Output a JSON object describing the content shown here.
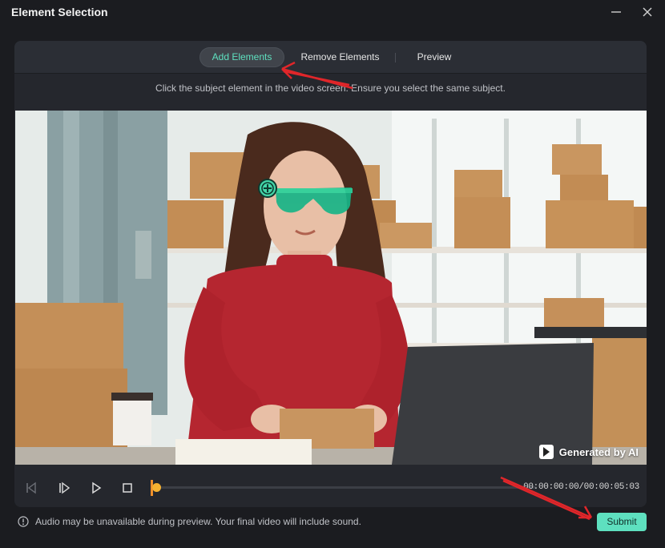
{
  "window": {
    "title": "Element Selection",
    "minimize_icon": "minimize-icon",
    "close_icon": "close-icon"
  },
  "tabs": [
    {
      "label": "Add Elements",
      "active": true
    },
    {
      "label": "Remove Elements",
      "active": false
    },
    {
      "label": "Preview",
      "active": false
    }
  ],
  "instruction": "Click the subject element in the video screen. Ensure you select the same subject.",
  "video": {
    "watermark": "Generated by AI",
    "selection_marker_icon": "add-circle-icon"
  },
  "player": {
    "controls": [
      "prev-frame-icon",
      "next-frame-icon",
      "play-icon",
      "stop-icon"
    ],
    "timecode": "00:00:00:00/00:00:05:03",
    "progress": 0.0
  },
  "footer": {
    "note": "Audio may be unavailable during preview. Your final video will include sound.",
    "submit_label": "Submit"
  },
  "colors": {
    "accent": "#5ee0bf",
    "annotation_arrow": "#e0262a",
    "playhead": "#f7b231"
  }
}
